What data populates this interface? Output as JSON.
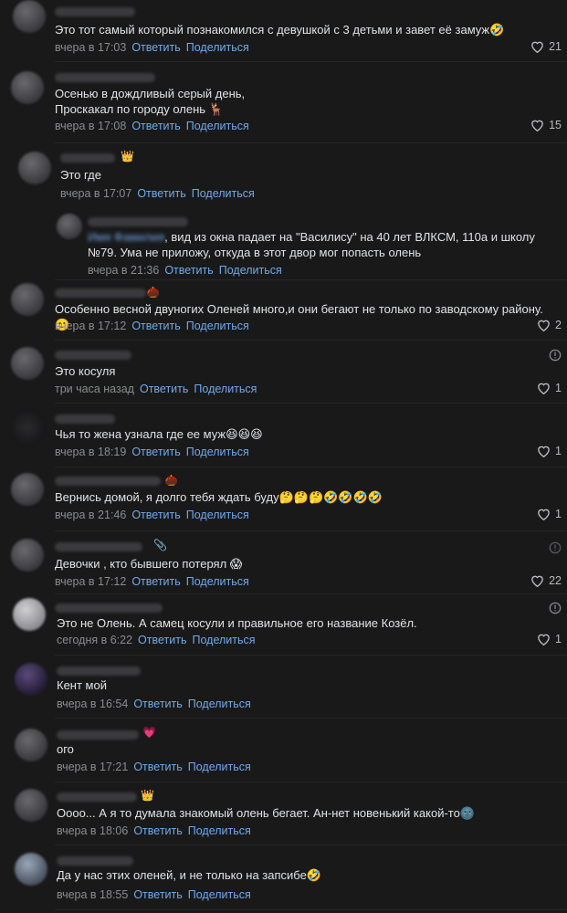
{
  "actions": {
    "reply": "Ответить",
    "share": "Поделиться"
  },
  "comments": [
    {
      "text": "Это тот самый который познакомился с девушкой с 3 детьми и завет её замуж🤣",
      "time": "вчера в 17:03",
      "likes": "21"
    },
    {
      "text": "Осенью в дождливый серый день,\nПроскакал по городу олень 🦌",
      "time": "вчера в 17:08",
      "likes": "15"
    },
    {
      "badge": "👑",
      "text": "Это где",
      "time": "вчера в 17:07"
    },
    {
      "text": ", вид из окна падает на \"Василису\" на 40 лет ВЛКСМ, 110а и школу №79. Ума не приложу, откуда в этот двор мог попасть олень",
      "time": "вчера в 21:36"
    },
    {
      "badge": "🌰",
      "text": "Особенно весной двуногих Оленей много,и они бегают не только по заводскому району.🙂",
      "time": "вчера в 17:12",
      "likes": "2"
    },
    {
      "text": "Это косуля",
      "time": "три часа назад",
      "likes": "1"
    },
    {
      "text": "Чья то жена узнала где ее муж😆😆😆",
      "time": "вчера в 18:19",
      "likes": "1"
    },
    {
      "badge": "🌰",
      "text": "Вернись домой, я долго тебя ждать буду🤔🤔🤔🤣🤣🤣🤣",
      "time": "вчера в 21:46",
      "likes": "1"
    },
    {
      "badge": "📎",
      "text": "Девочки , кто бывшего потерял 😱",
      "time": "вчера в 17:12",
      "likes": "22"
    },
    {
      "text": "Это не Олень. А самец косули и правильное его название Козёл.",
      "time": "сегодня в 6:22",
      "likes": "1"
    },
    {
      "text": "Кент мой",
      "time": "вчера в 16:54"
    },
    {
      "badge": "💗",
      "text": "ого",
      "time": "вчера в 17:21"
    },
    {
      "badge": "👑",
      "text": "Оооо... А я то думала знакомый олень бегает. Ан-нет новенький какой-то🌚",
      "time": "вчера в 18:06"
    },
    {
      "text": "Да у нас этих оленей, и не только на запсибе🤣",
      "time": "вчера в 18:55"
    }
  ],
  "colors": {
    "accent": "#71aaeb",
    "background": "#19191a",
    "text": "#e1e3e6",
    "muted": "#8a8c90"
  },
  "icons": {
    "like": "heart-icon",
    "report": "info-circle-icon"
  }
}
